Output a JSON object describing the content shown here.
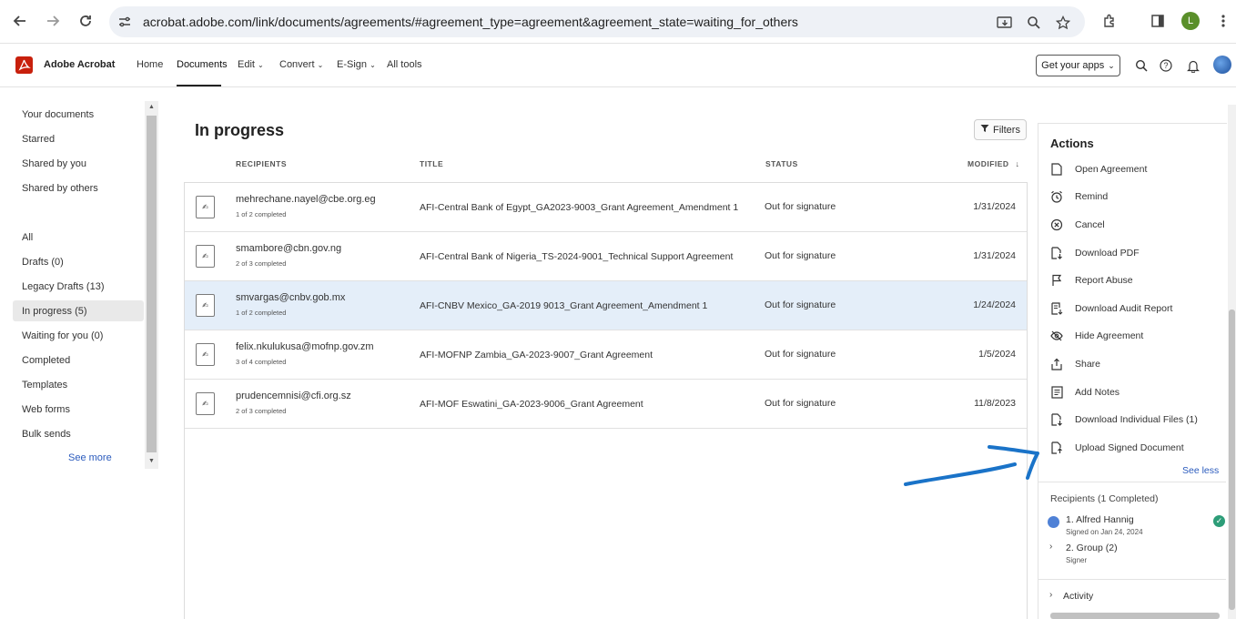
{
  "browser": {
    "url": "acrobat.adobe.com/link/documents/agreements/#agreement_type=agreement&agreement_state=waiting_for_others",
    "profile_initial": "L"
  },
  "appbar": {
    "brand": "Adobe Acrobat",
    "nav": [
      "Home",
      "Documents",
      "Edit",
      "Convert",
      "E-Sign",
      "All tools"
    ],
    "active_nav": "Documents",
    "get_apps": "Get your apps"
  },
  "sidebar": {
    "top_items": [
      "Your documents",
      "Starred",
      "Shared by you",
      "Shared by others"
    ],
    "items": [
      "All",
      "Drafts (0)",
      "Legacy Drafts (13)",
      "In progress (5)",
      "Waiting for you (0)",
      "Completed",
      "Templates",
      "Web forms",
      "Bulk sends"
    ],
    "selected": "In progress (5)",
    "see_more": "See more"
  },
  "main": {
    "title": "In progress",
    "filters_label": "Filters",
    "columns": {
      "recipients": "RECIPIENTS",
      "title": "TITLE",
      "status": "STATUS",
      "modified": "MODIFIED"
    },
    "rows": [
      {
        "email": "mehrechane.nayel@cbe.org.eg",
        "count": "1 of 2 completed",
        "title": "AFI-Central Bank of Egypt_GA2023-9003_Grant Agreement_Amendment 1",
        "status": "Out for signature",
        "date": "1/31/2024",
        "selected": false
      },
      {
        "email": "smambore@cbn.gov.ng",
        "count": "2 of 3 completed",
        "title": "AFI-Central Bank of Nigeria_TS-2024-9001_Technical Support Agreement",
        "status": "Out for signature",
        "date": "1/31/2024",
        "selected": false
      },
      {
        "email": "smvargas@cnbv.gob.mx",
        "count": "1 of 2 completed",
        "title": "AFI-CNBV Mexico_GA-2019 9013_Grant Agreement_Amendment 1",
        "status": "Out for signature",
        "date": "1/24/2024",
        "selected": true
      },
      {
        "email": "felix.nkulukusa@mofnp.gov.zm",
        "count": "3 of 4 completed",
        "title": "AFI-MOFNP Zambia_GA-2023-9007_Grant Agreement",
        "status": "Out for signature",
        "date": "1/5/2024",
        "selected": false
      },
      {
        "email": "prudencemnisi@cfi.org.sz",
        "count": "2 of 3 completed",
        "title": "AFI-MOF Eswatini_GA-2023-9006_Grant Agreement",
        "status": "Out for signature",
        "date": "11/8/2023",
        "selected": false
      }
    ]
  },
  "panel": {
    "actions_title": "Actions",
    "actions": [
      {
        "label": "Open Agreement",
        "icon": "document-icon"
      },
      {
        "label": "Remind",
        "icon": "alarm-clock-icon"
      },
      {
        "label": "Cancel",
        "icon": "cancel-circle-icon"
      },
      {
        "label": "Download PDF",
        "icon": "download-document-icon"
      },
      {
        "label": "Report Abuse",
        "icon": "flag-icon"
      },
      {
        "label": "Download Audit Report",
        "icon": "audit-report-icon"
      },
      {
        "label": "Hide Agreement",
        "icon": "eye-off-icon"
      },
      {
        "label": "Share",
        "icon": "share-icon"
      },
      {
        "label": "Add Notes",
        "icon": "notes-icon"
      },
      {
        "label": "Download Individual Files (1)",
        "icon": "download-files-icon"
      },
      {
        "label": "Upload Signed Document",
        "icon": "upload-document-icon"
      }
    ],
    "see_less": "See less",
    "recipients_header": "Recipients (1 Completed)",
    "recipients": [
      {
        "name": "1. Alfred Hannig",
        "sub": "Signed on Jan 24, 2024"
      },
      {
        "name": "2. Group (2)",
        "sub": "Signer"
      }
    ],
    "activity": "Activity"
  },
  "colors": {
    "accent_blue": "#2b5bbd",
    "selected_row": "#e4eef9",
    "acrobat_red": "#c8200c",
    "annotation_blue": "#1a73c8",
    "completed_green": "#2d9d78"
  }
}
